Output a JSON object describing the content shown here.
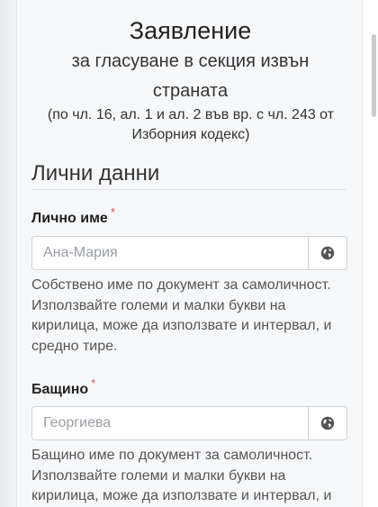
{
  "header": {
    "title": "Заявление",
    "subtitle": "за гласуване в секция извън страната",
    "legal": "(по чл. 16, ал. 1 и ал. 2 във вр. с чл. 243 от Изборния кодекс)"
  },
  "section": {
    "title": "Лични данни"
  },
  "fields": {
    "first_name": {
      "label": "Лично име",
      "required_mark": "*",
      "placeholder": "Ана-Мария",
      "value": "",
      "help": "Собствено име по документ за самоличност. Използвайте големи и малки букви на кирилица, може да използвате и интервал, и средно тире.",
      "addon_icon": "globe-icon"
    },
    "middle_name": {
      "label": "Бащино",
      "required_mark": "*",
      "placeholder": "Георгиева",
      "value": "",
      "help": "Бащино име по документ за самоличност. Използвайте големи и малки букви на кирилица, може да използвате и интервал, и",
      "addon_icon": "globe-icon"
    }
  },
  "colors": {
    "required": "#d9534f",
    "page_background": "#f7f8fa",
    "border": "#cfd3d7"
  }
}
